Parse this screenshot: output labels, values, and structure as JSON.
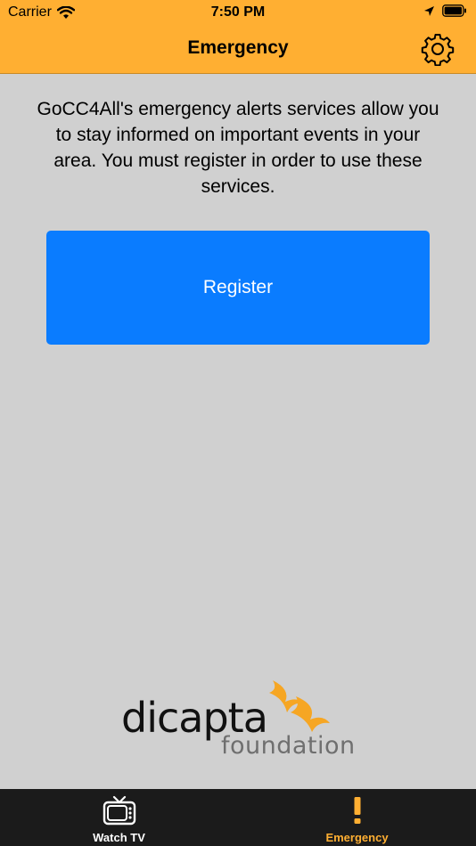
{
  "status_bar": {
    "carrier": "Carrier",
    "time": "7:50 PM",
    "icons": [
      "wifi-icon",
      "location-arrow-icon",
      "battery-icon"
    ]
  },
  "nav": {
    "title": "Emergency",
    "settings_icon": "gear-icon"
  },
  "main": {
    "intro_text": "GoCC4All's emergency alerts services allow you to stay informed on important events in your area. You must register in order to use these services.",
    "register_label": "Register"
  },
  "logo": {
    "wordmark": "dicapta",
    "subtitle": "foundation"
  },
  "tab_bar": {
    "tabs": [
      {
        "label": "Watch TV",
        "icon": "tv-icon",
        "active": false
      },
      {
        "label": "Emergency",
        "icon": "exclamation-icon",
        "active": true
      }
    ]
  },
  "colors": {
    "accent": "#ffaf32",
    "button": "#0a7cff",
    "background": "#d0d0d0",
    "tab_bar": "#1b1b1b"
  }
}
